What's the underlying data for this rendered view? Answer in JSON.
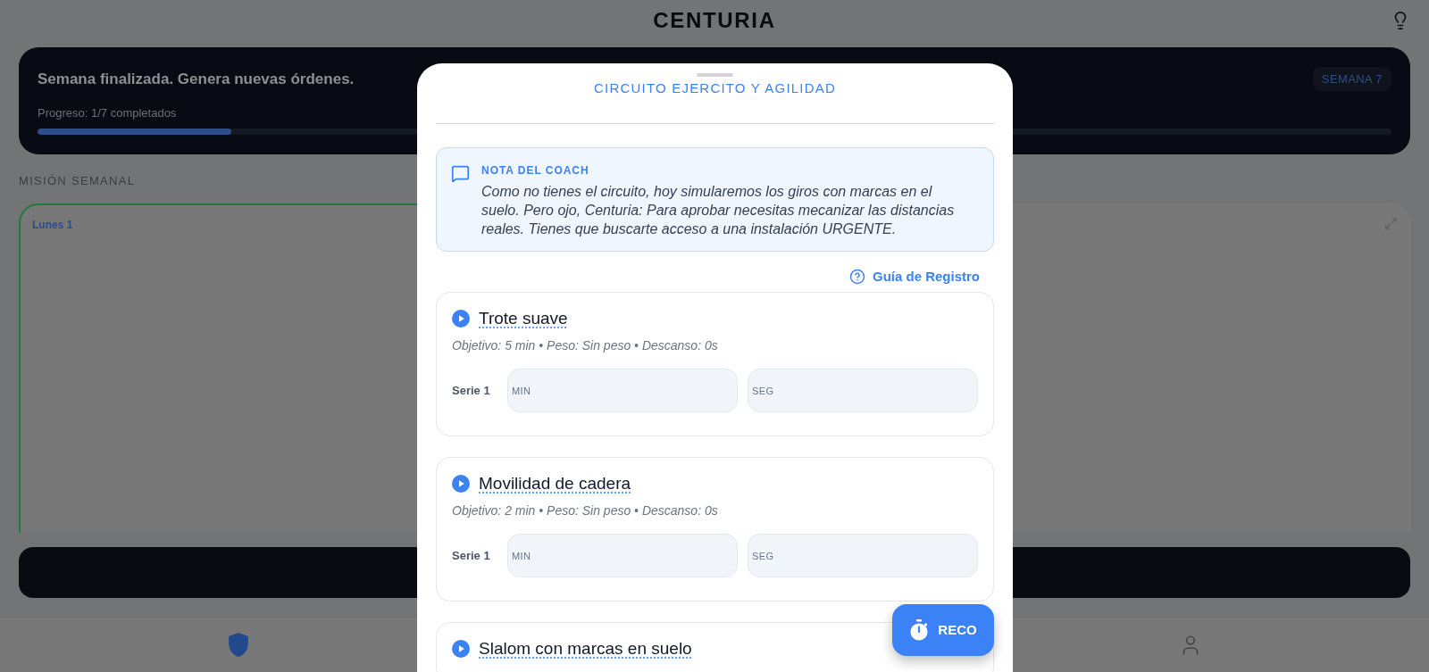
{
  "header": {
    "title": "CENTURIA"
  },
  "banner": {
    "message": "Semana finalizada. Genera nuevas órdenes.",
    "week_badge": "SEMANA 7",
    "progress_text": "Progreso: 1/7 completados",
    "progress": {
      "level": 0.143
    }
  },
  "section_title": "MISIÓN SEMANAL",
  "day_cards": [
    {
      "label": "Lunes 1",
      "selected": true
    },
    {
      "selected": false,
      "expandable": true
    }
  ],
  "bottom_nav": [
    {
      "selected": true
    },
    {
      "selected": false
    }
  ],
  "modal": {
    "title": "CIRCUITO EJERCITO Y AGILIDAD",
    "coach_note": {
      "heading": "NOTA DEL COACH",
      "text": "Como no tienes el circuito, hoy simularemos los giros con marcas en el suelo. Pero ojo, Centuria: Para aprobar necesitas mecanizar las distancias reales. Tienes que buscarte acceso a una instalación URGENTE."
    },
    "guide_link": "Guía de Registro",
    "exercises": [
      {
        "name": "Trote suave",
        "details": "Objetivo: 5 min • Peso: Sin peso • Descanso: 0s",
        "sets": [
          {
            "label": "Serie 1",
            "fields": [
              {
                "placeholder": "MIN"
              },
              {
                "placeholder": "SEG"
              }
            ]
          }
        ]
      },
      {
        "name": "Movilidad de cadera",
        "details": "Objetivo: 2 min • Peso: Sin peso • Descanso: 0s",
        "sets": [
          {
            "label": "Serie 1",
            "fields": [
              {
                "placeholder": "MIN"
              },
              {
                "placeholder": "SEG"
              }
            ]
          }
        ]
      },
      {
        "name": "Slalom con marcas en suelo"
      }
    ],
    "timer_button": "RECO"
  }
}
